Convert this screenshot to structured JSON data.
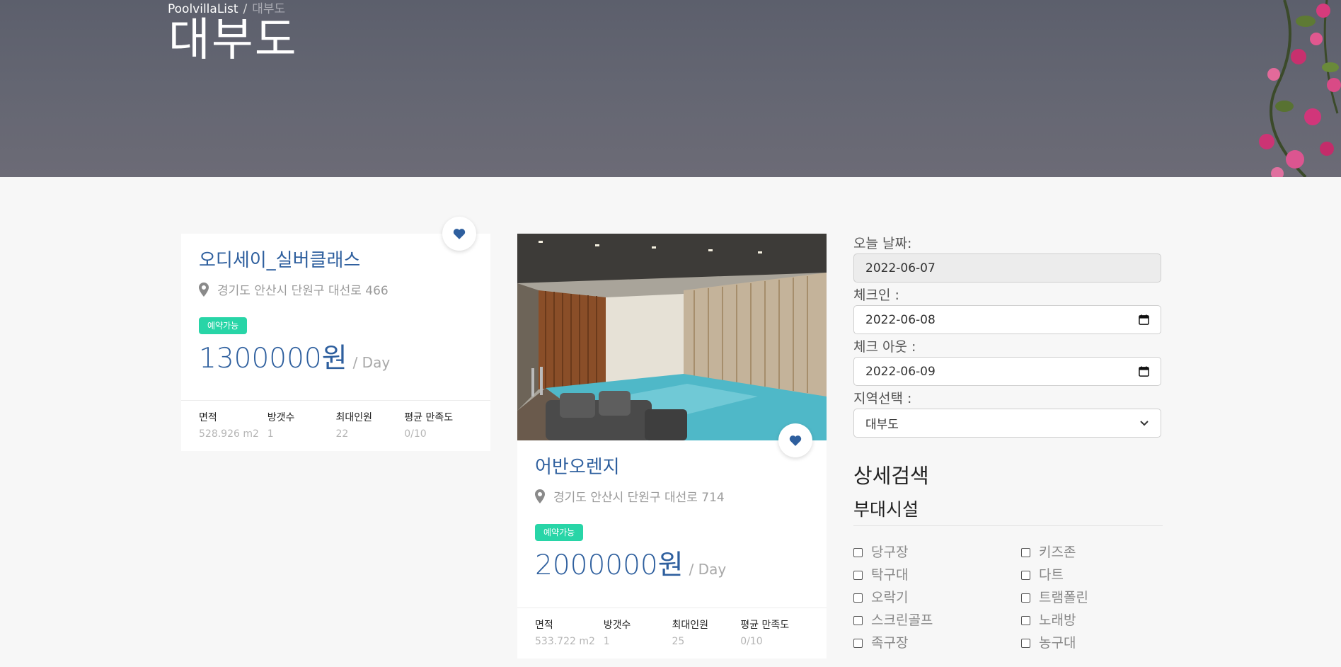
{
  "breadcrumb": {
    "root": "PoolvillaList",
    "separator": "/",
    "current": "대부도"
  },
  "page_title": "대부도",
  "listings": [
    {
      "name": "오디세이_실버클래스",
      "address": "경기도 안산시 단원구 대선로 466",
      "badge": "예약가능",
      "price": "1300000원",
      "price_unit": "/ Day",
      "stats": [
        {
          "label": "면적",
          "value": "528.926 m2"
        },
        {
          "label": "방갯수",
          "value": "1"
        },
        {
          "label": "최대인원",
          "value": "22"
        },
        {
          "label": "평균 만족도",
          "value": "0/10"
        }
      ]
    },
    {
      "name": "어반오렌지",
      "address": "경기도 안산시 단원구 대선로 714",
      "badge": "예약가능",
      "price": "2000000원",
      "price_unit": "/ Day",
      "stats": [
        {
          "label": "면적",
          "value": "533.722 m2"
        },
        {
          "label": "방갯수",
          "value": "1"
        },
        {
          "label": "최대인원",
          "value": "25"
        },
        {
          "label": "평균 만족도",
          "value": "0/10"
        }
      ]
    }
  ],
  "search": {
    "today_label": "오늘 날짜:",
    "today_value": "2022-06-07",
    "checkin_label": "체크인 :",
    "checkin_value": "2022-06-08",
    "checkout_label": "체크 아웃 :",
    "checkout_value": "2022-06-09",
    "region_label": "지역선택 :",
    "region_value": "대부도"
  },
  "detail_search_title": "상세검색",
  "facilities_title": "부대시설",
  "facilities": [
    "당구장",
    "키즈존",
    "탁구대",
    "다트",
    "오락기",
    "트램폴린",
    "스크린골프",
    "노래방",
    "족구장",
    "농구대"
  ],
  "colors": {
    "accent": "#2e5f9e",
    "badge": "#28d5a7",
    "hero": "#62646f"
  },
  "icons": [
    "heart-icon",
    "map-pin-icon",
    "calendar-icon",
    "chevron-down-icon"
  ]
}
